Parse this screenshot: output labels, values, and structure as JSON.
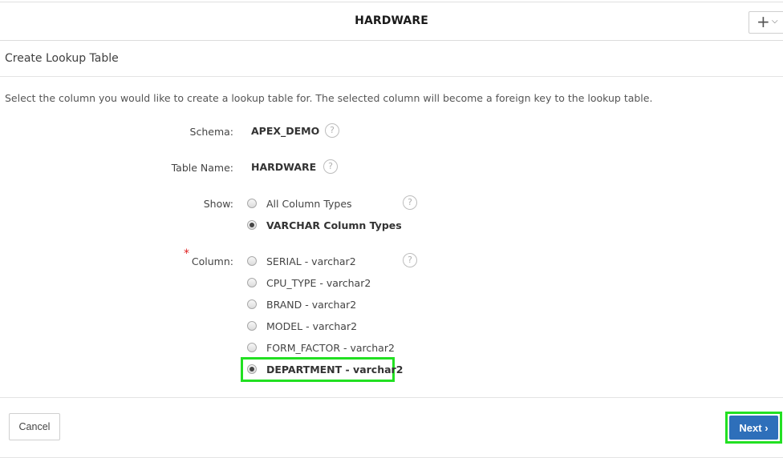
{
  "header": {
    "title": "HARDWARE",
    "plus_icon": "+",
    "chevron_icon": "⌄"
  },
  "region": {
    "title": "Create Lookup Table"
  },
  "instructions": "Select the column you would like to create a lookup table for. The selected column will become a foreign key to the lookup table.",
  "form": {
    "schema": {
      "label": "Schema:",
      "value": "APEX_DEMO"
    },
    "table_name": {
      "label": "Table Name:",
      "value": "HARDWARE"
    },
    "show": {
      "label": "Show:",
      "options": [
        "All Column Types",
        "VARCHAR Column Types"
      ],
      "selected": "VARCHAR Column Types"
    },
    "column": {
      "required_mark": "*",
      "label": "Column:",
      "options": [
        "SERIAL - varchar2",
        "CPU_TYPE - varchar2",
        "BRAND - varchar2",
        "MODEL - varchar2",
        "FORM_FACTOR - varchar2",
        "DEPARTMENT - varchar2"
      ],
      "selected": "DEPARTMENT - varchar2"
    },
    "help_icon": "?"
  },
  "footer": {
    "cancel_label": "Cancel",
    "next_label": "Next"
  },
  "colors": {
    "next_button": "#2e6fba",
    "highlight": "#22e022",
    "required": "#e02020"
  }
}
